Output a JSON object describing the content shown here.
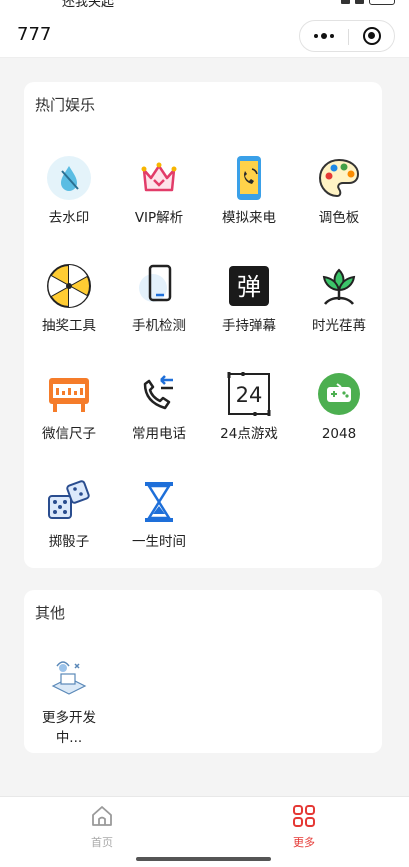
{
  "statusbar": {
    "text": "还我关起"
  },
  "navbar": {
    "title": "777"
  },
  "sections": [
    {
      "title": "热门娱乐",
      "items": [
        {
          "label": "去水印",
          "icon": "water-drop-icon"
        },
        {
          "label": "VIP解析",
          "icon": "crown-icon"
        },
        {
          "label": "模拟来电",
          "icon": "phone-call-icon"
        },
        {
          "label": "调色板",
          "icon": "palette-icon"
        },
        {
          "label": "抽奖工具",
          "icon": "lottery-wheel-icon"
        },
        {
          "label": "手机检测",
          "icon": "phone-check-icon"
        },
        {
          "label": "手持弹幕",
          "icon": "danmaku-icon",
          "glyph": "弹"
        },
        {
          "label": "时光荏苒",
          "icon": "sprout-icon"
        },
        {
          "label": "微信尺子",
          "icon": "ruler-icon"
        },
        {
          "label": "常用电话",
          "icon": "incoming-call-icon"
        },
        {
          "label": "24点游戏",
          "icon": "twenty-four-game-icon",
          "glyph": "24"
        },
        {
          "label": "2048",
          "icon": "game-console-icon"
        },
        {
          "label": "掷骰子",
          "icon": "dice-icon"
        },
        {
          "label": "一生时间",
          "icon": "hourglass-icon"
        }
      ]
    },
    {
      "title": "其他",
      "items": [
        {
          "label": "更多开发中...",
          "icon": "development-icon"
        }
      ]
    }
  ],
  "tabbar": {
    "tabs": [
      {
        "label": "首页",
        "icon": "home-icon",
        "active": false
      },
      {
        "label": "更多",
        "icon": "grid-icon",
        "active": true
      }
    ]
  },
  "colors": {
    "accent": "#e53935",
    "inactive": "#aaaaaa",
    "icon_blue": "#1e6fd9"
  }
}
